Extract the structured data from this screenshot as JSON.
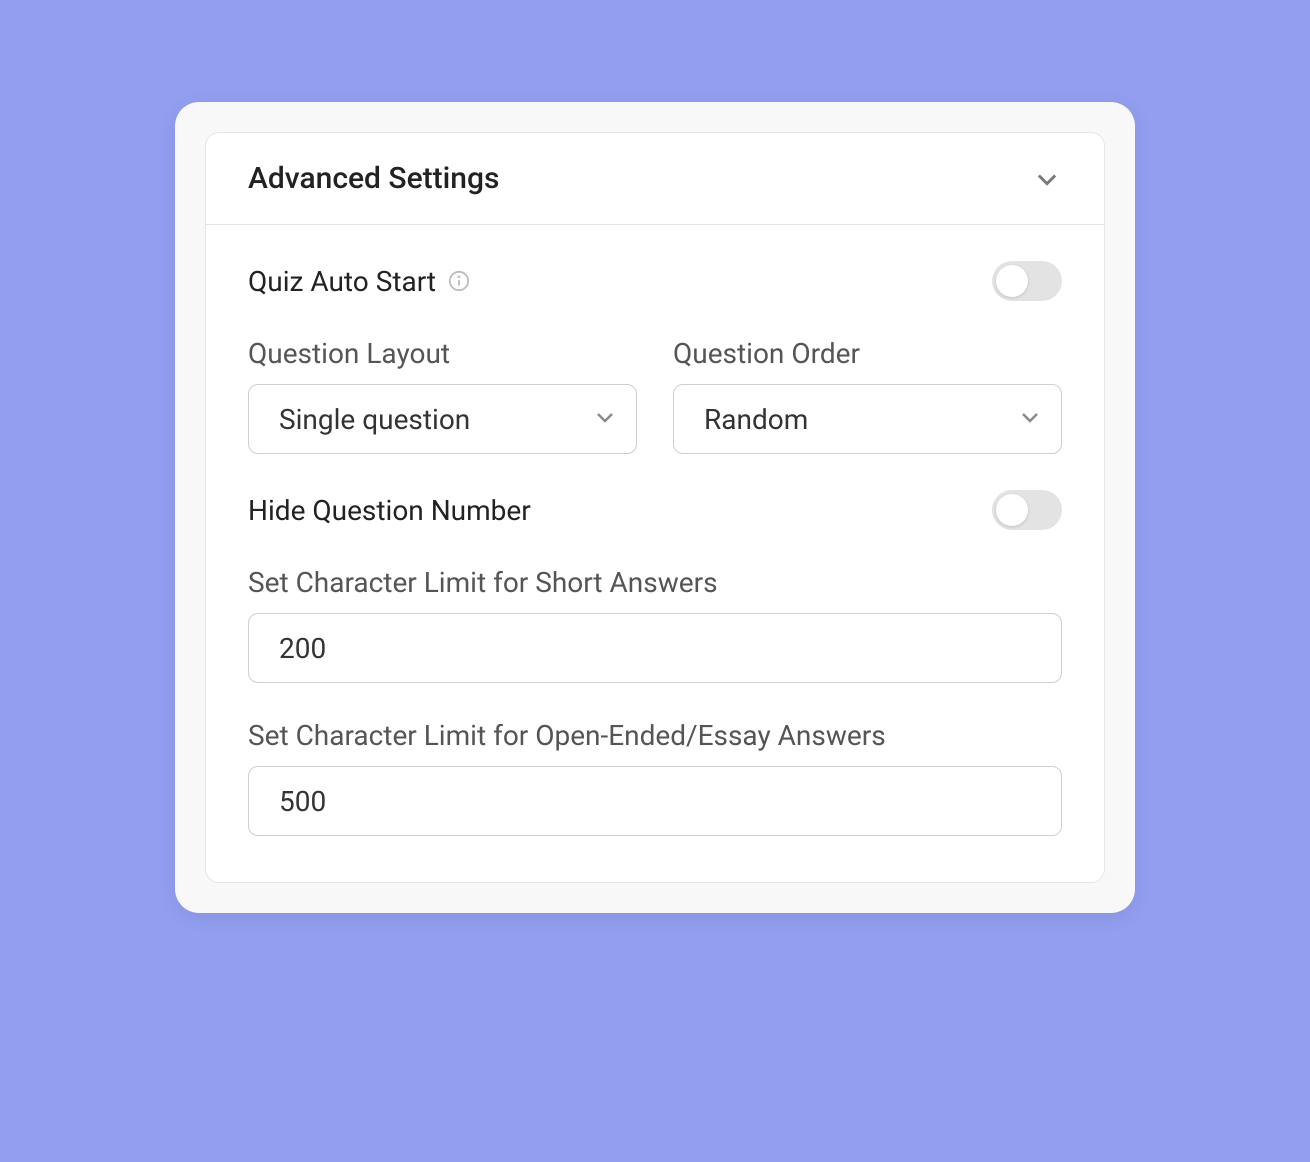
{
  "panel": {
    "title": "Advanced Settings"
  },
  "settings": {
    "quiz_auto_start": {
      "label": "Quiz Auto Start",
      "value": false
    },
    "question_layout": {
      "label": "Question Layout",
      "value": "Single question"
    },
    "question_order": {
      "label": "Question Order",
      "value": "Random"
    },
    "hide_question_number": {
      "label": "Hide Question Number",
      "value": false
    },
    "short_answer_limit": {
      "label": "Set Character Limit for Short Answers",
      "value": "200"
    },
    "essay_answer_limit": {
      "label": "Set Character Limit for Open-Ended/Essay Answers",
      "value": "500"
    }
  }
}
